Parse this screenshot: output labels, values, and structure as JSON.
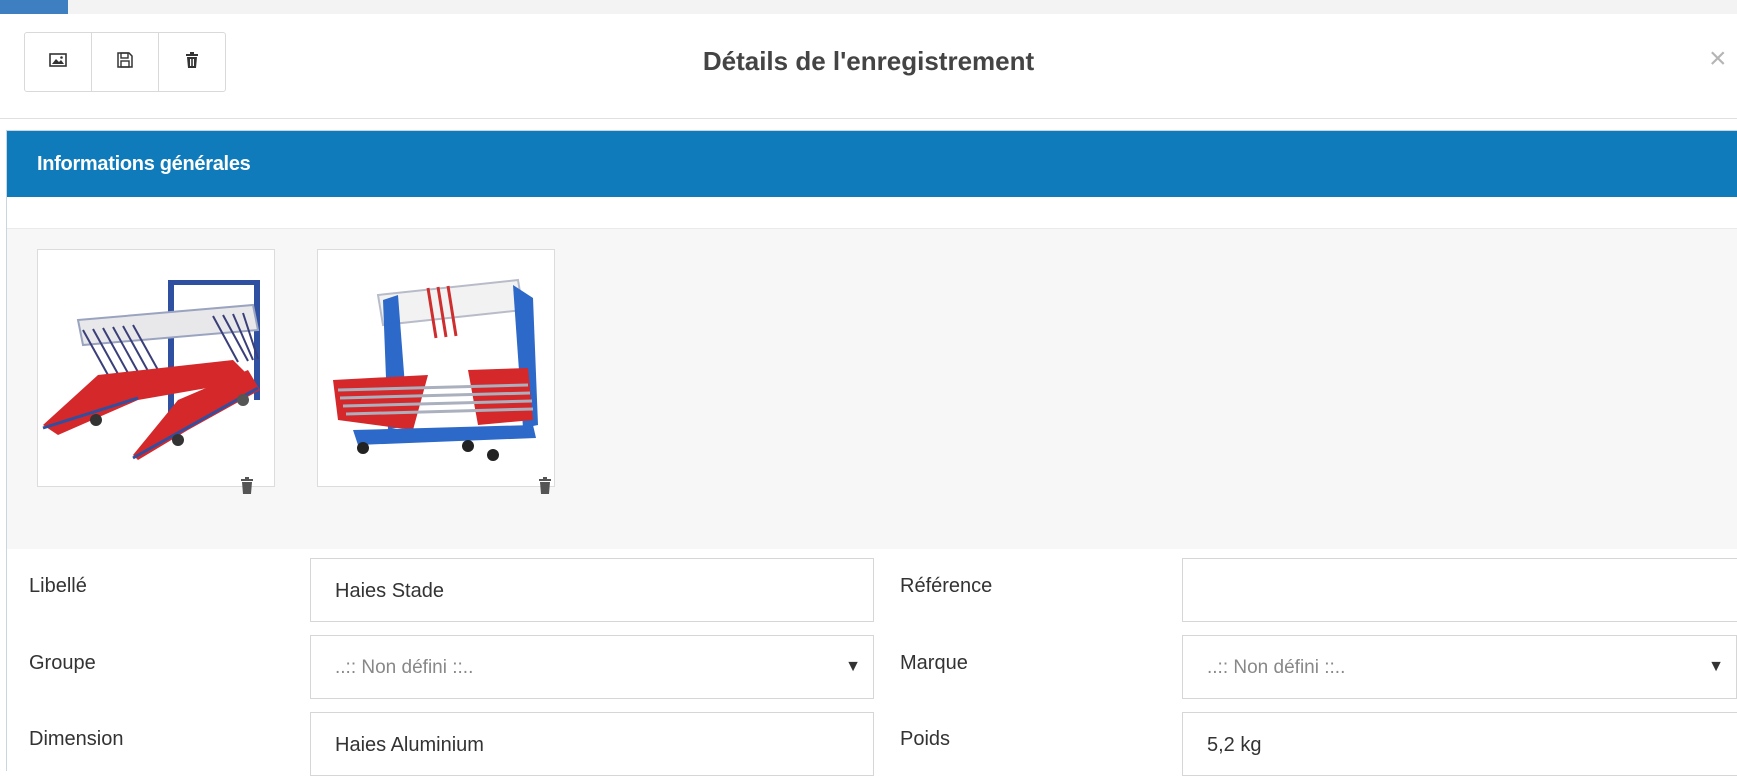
{
  "modal": {
    "title": "Détails de l'enregistrement",
    "close_symbol": "×"
  },
  "toolbar": {
    "buttons": [
      {
        "icon": "image-icon"
      },
      {
        "icon": "save-icon"
      },
      {
        "icon": "trash-icon"
      }
    ]
  },
  "panel": {
    "heading": "Informations générales"
  },
  "gallery": {
    "images": [
      {
        "icon": "hurdle-cart-photo-icon"
      },
      {
        "icon": "hurdle-trolley-photo-icon"
      }
    ]
  },
  "form": {
    "libelle": {
      "label": "Libellé",
      "value": "Haies Stade"
    },
    "reference": {
      "label": "Référence",
      "value": ""
    },
    "groupe": {
      "label": "Groupe",
      "value": "..:: Non défini ::.."
    },
    "marque": {
      "label": "Marque",
      "value": "..:: Non défini ::.."
    },
    "dimension": {
      "label": "Dimension",
      "value": "Haies Aluminium"
    },
    "poids": {
      "label": "Poids",
      "value": "5,2 kg"
    }
  },
  "colors": {
    "accent": "#0f7bbb",
    "tab": "#3d7fc0"
  }
}
